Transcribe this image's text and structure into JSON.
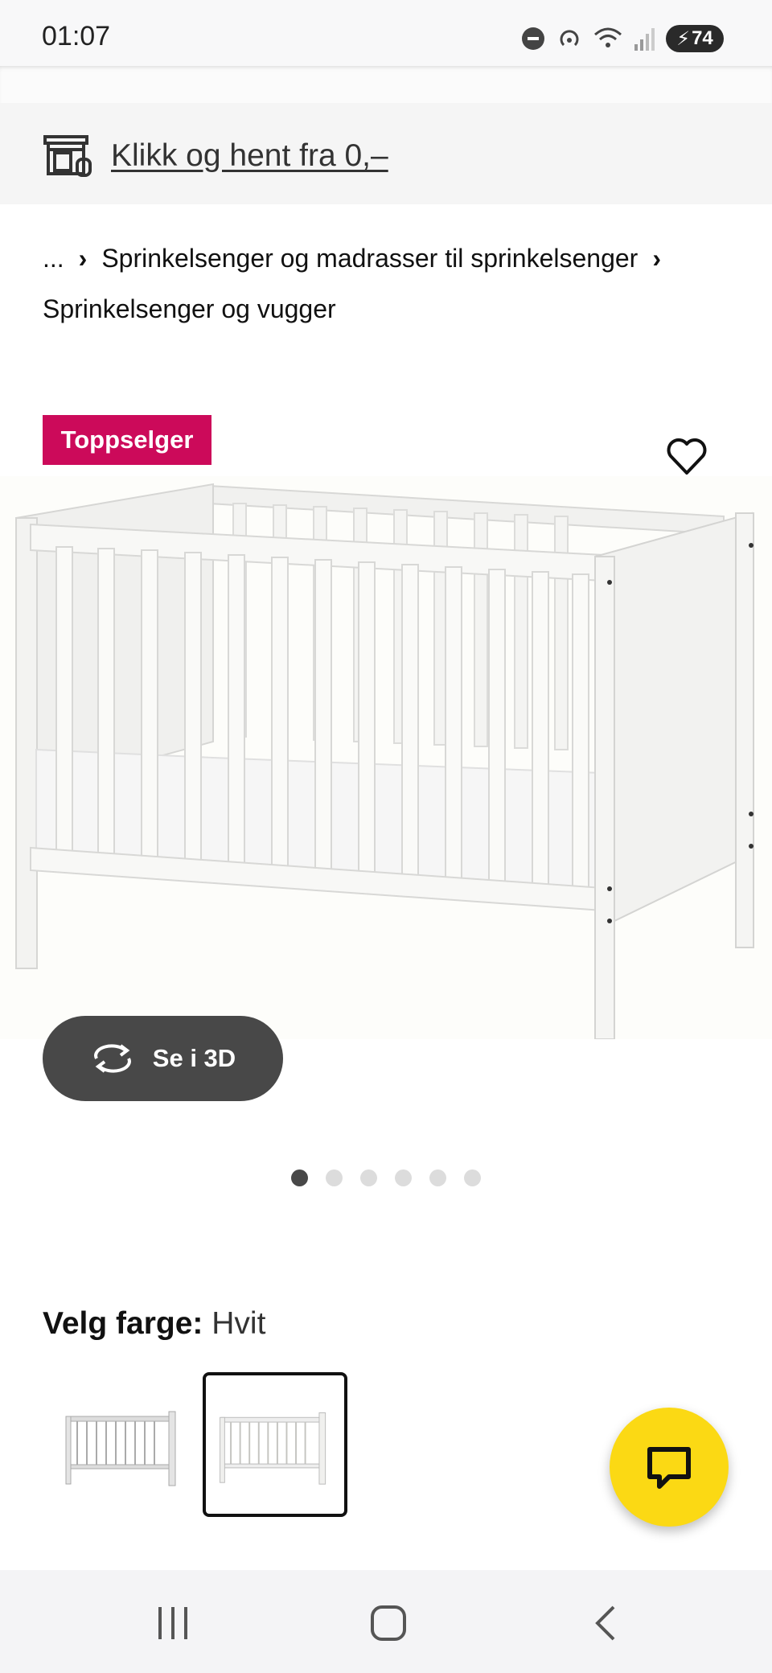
{
  "status_bar": {
    "time": "01:07",
    "battery": "74"
  },
  "promo": {
    "link_text": "Klikk og hent fra 0,–"
  },
  "breadcrumb": {
    "ellipsis": "...",
    "items": [
      "Sprinkelsenger og madrasser til sprinkelsenger",
      "Sprinkelsenger og vugger"
    ]
  },
  "product": {
    "badge": "Toppselger",
    "view_3d_label": "Se i 3D",
    "carousel_pages": 6,
    "carousel_active": 1
  },
  "color_picker": {
    "label": "Velg farge:",
    "value": "Hvit"
  },
  "colors": {
    "badge": "#cc0a5a",
    "chat_fab": "#fbd914",
    "button_dark": "#484848"
  },
  "icons": [
    "store-pickup-icon",
    "heart-icon",
    "rotate-3d-icon",
    "chat-icon",
    "recents-icon",
    "home-icon",
    "back-icon"
  ]
}
